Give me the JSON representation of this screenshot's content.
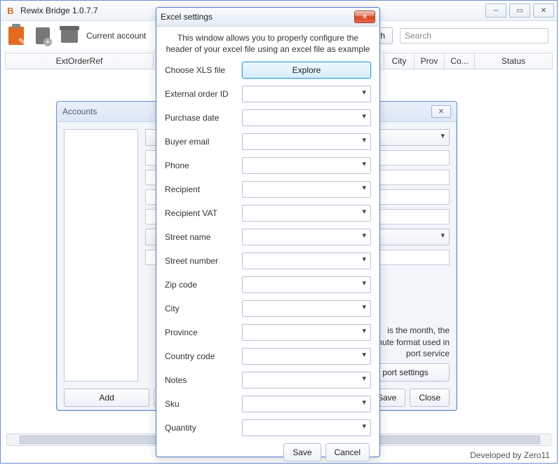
{
  "window": {
    "title": "Rewix Bridge 1.0.7.7",
    "footer": "Developed by Zero11"
  },
  "toolbar": {
    "current_label": "Current account",
    "refresh_label": "Refresh",
    "search_placeholder": "Search"
  },
  "grid": {
    "columns": [
      "ExtOrderRef",
      "City",
      "Prov",
      "Co...",
      "Status"
    ]
  },
  "accounts": {
    "title": "Accounts",
    "add_label": "Add",
    "save_label": "Save",
    "close_label": "Close",
    "help": "is the month, the minute format used in port service",
    "port_settings_label": "port settings"
  },
  "dialog": {
    "title": "Excel settings",
    "description": "This window allows you to properly configure the header of your excel file using an excel file as example",
    "choose_label": "Choose XLS file",
    "explore_label": "Explore",
    "fields": [
      "External order ID",
      "Purchase date",
      "Buyer email",
      "Phone",
      "Recipient",
      "Recipient VAT",
      "Street name",
      "Street number",
      "Zip code",
      "City",
      "Province",
      "Country code",
      "Notes",
      "Sku",
      "Quantity"
    ],
    "save_label": "Save",
    "cancel_label": "Cancel"
  }
}
